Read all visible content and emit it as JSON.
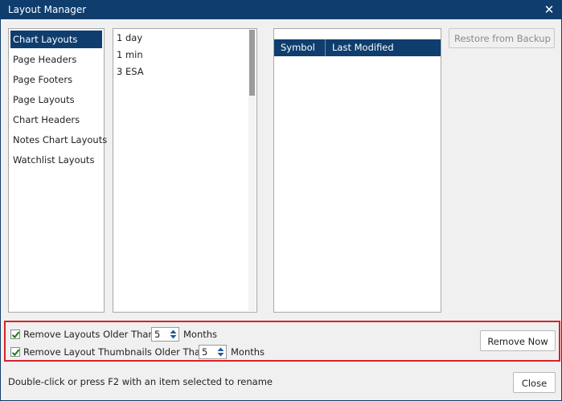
{
  "window": {
    "title": "Layout Manager",
    "close_icon": "✕"
  },
  "categories": [
    {
      "label": "Chart Layouts",
      "selected": true
    },
    {
      "label": "Page Headers",
      "selected": false
    },
    {
      "label": "Page Footers",
      "selected": false
    },
    {
      "label": "Page Layouts",
      "selected": false
    },
    {
      "label": "Chart Headers",
      "selected": false
    },
    {
      "label": "Notes Chart Layouts",
      "selected": false
    },
    {
      "label": "Watchlist Layouts",
      "selected": false
    }
  ],
  "layouts": [
    {
      "label": "1 day"
    },
    {
      "label": "1 min"
    },
    {
      "label": "3 ESA"
    }
  ],
  "symbol_table": {
    "columns": [
      "Symbol",
      "Last Modified"
    ],
    "rows": []
  },
  "restore_button": {
    "label": "Restore from Backup",
    "enabled": false
  },
  "options": {
    "remove_layouts": {
      "label": "Remove Layouts Older Than",
      "checked": true,
      "value": "5",
      "unit": "Months"
    },
    "remove_thumbnails": {
      "label": "Remove Layout Thumbnails Older Than",
      "checked": true,
      "value": "5",
      "unit": "Months"
    },
    "remove_now_label": "Remove Now"
  },
  "footer": {
    "hint": "Double-click or press F2 with an item selected to rename",
    "close_label": "Close"
  },
  "colors": {
    "accent": "#0f3d6e",
    "highlight_border": "#d9222a",
    "checkmark": "#1a7a1a"
  }
}
